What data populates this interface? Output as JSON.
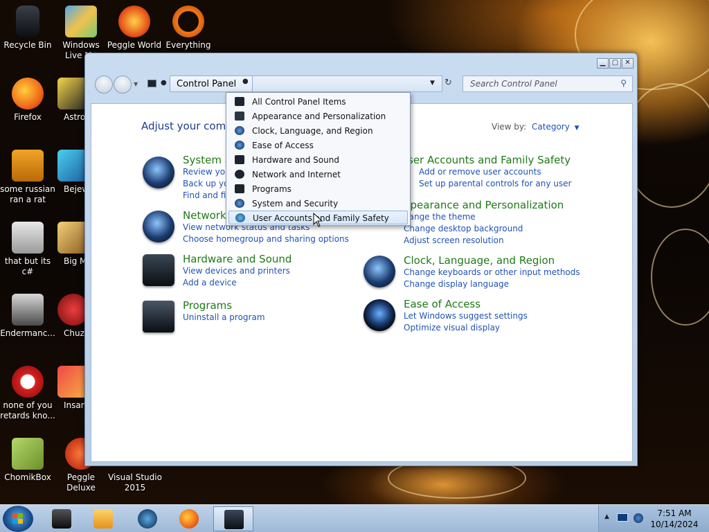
{
  "desktop": {
    "icons": [
      {
        "label": "Recycle Bin",
        "icon": "recycle-bin-icon"
      },
      {
        "label": "Windows Live Ma",
        "icon": "windows-live-mail-icon"
      },
      {
        "label": "Peggle World",
        "icon": "peggle-world-icon"
      },
      {
        "label": "Everything",
        "icon": "everything-icon"
      },
      {
        "label": "Firefox",
        "icon": "firefox-icon"
      },
      {
        "label": "Astro Delu",
        "icon": "astro-icon"
      },
      {
        "label": "some russian ran a rat",
        "icon": "shortcut-icon"
      },
      {
        "label": "Bejew Delu",
        "icon": "bejeweled-icon"
      },
      {
        "label": "that but its c#",
        "icon": "shortcut-icon"
      },
      {
        "label": "Big Mo Delu",
        "icon": "big-money-icon"
      },
      {
        "label": "Endermanc...",
        "icon": "shortcut-icon"
      },
      {
        "label": "Chuz Delu",
        "icon": "chuzzle-icon"
      },
      {
        "label": "none of you retards kno...",
        "icon": "shortcut-icon"
      },
      {
        "label": "Insaniq Delu",
        "icon": "insaniquarium-icon"
      },
      {
        "label": "ChomikBox",
        "icon": "chomikbox-icon"
      },
      {
        "label": "Peggle Deluxe",
        "icon": "peggle-deluxe-icon"
      },
      {
        "label": "Visual Studio 2015",
        "icon": "visual-studio-icon"
      }
    ]
  },
  "window": {
    "address": {
      "crumb": "Control Panel",
      "sep": "▸"
    },
    "search_placeholder": "Search Control Panel",
    "heading": "Adjust your comp",
    "view_by_label": "View by:",
    "view_by_value": "Category",
    "categories_left": [
      {
        "title": "System a",
        "links": [
          "Review you",
          "Back up you",
          "Find and fix"
        ],
        "icon": "system-security-icon"
      },
      {
        "title": "Network",
        "links": [
          "View network status and tasks",
          "Choose homegroup and sharing options"
        ],
        "icon": "network-icon"
      },
      {
        "title": "Hardware and Sound",
        "links": [
          "View devices and printers",
          "Add a device"
        ],
        "icon": "hardware-sound-icon"
      },
      {
        "title": "Programs",
        "links": [
          "Uninstall a program"
        ],
        "icon": "programs-icon"
      }
    ],
    "categories_right": [
      {
        "title": "ser Accounts and Family Safety",
        "links": [
          "Add or remove user accounts",
          "Set up parental controls for any user"
        ],
        "icon": "user-accounts-icon"
      },
      {
        "title": "ppearance and Personalization",
        "links": [
          "hange the theme",
          "Change desktop background",
          "Adjust screen resolution"
        ],
        "icon": "appearance-icon"
      },
      {
        "title": "Clock, Language, and Region",
        "links": [
          "Change keyboards or other input methods",
          "Change display language"
        ],
        "icon": "clock-language-icon"
      },
      {
        "title": "Ease of Access",
        "links": [
          "Let Windows suggest settings",
          "Optimize visual display"
        ],
        "icon": "ease-of-access-icon"
      }
    ]
  },
  "dropdown": {
    "items": [
      "All Control Panel Items",
      "Appearance and Personalization",
      "Clock, Language, and Region",
      "Ease of Access",
      "Hardware and Sound",
      "Network and Internet",
      "Programs",
      "System and Security",
      "User Accounts and Family Safety"
    ],
    "highlighted_index": 8
  },
  "taskbar": {
    "clock_time": "7:51 AM",
    "clock_date": "10/14/2024"
  },
  "colors": {
    "link": "#1f52b5",
    "category_title": "#1e7a18"
  }
}
